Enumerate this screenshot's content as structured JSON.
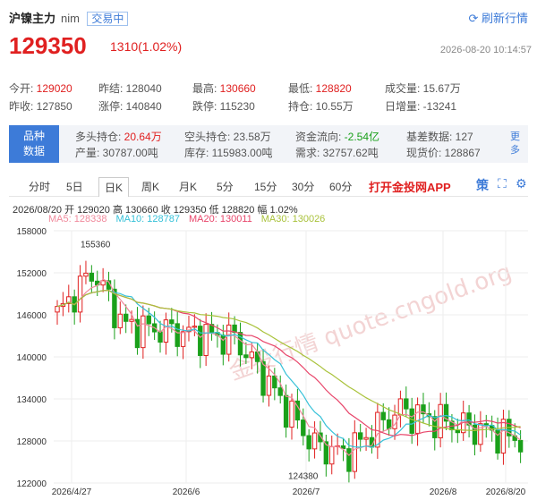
{
  "header": {
    "name": "沪镍主力",
    "code": "nim",
    "status": "交易中",
    "refresh_label": "刷新行情"
  },
  "quote": {
    "price": "129350",
    "change": "1310(1.02%)",
    "timestamp": "2026-08-20 10:14:57"
  },
  "stats": {
    "row1": [
      {
        "label": "今开:",
        "value": "129020",
        "color": "up"
      },
      {
        "label": "昨结:",
        "value": "128040",
        "color": ""
      },
      {
        "label": "最高:",
        "value": "130660",
        "color": "up"
      },
      {
        "label": "最低:",
        "value": "128820",
        "color": "up"
      },
      {
        "label": "成交量:",
        "value": "15.67万",
        "color": ""
      }
    ],
    "row2": [
      {
        "label": "昨收:",
        "value": "127850",
        "color": ""
      },
      {
        "label": "涨停:",
        "value": "140840",
        "color": ""
      },
      {
        "label": "跌停:",
        "value": "115230",
        "color": ""
      },
      {
        "label": "持仓:",
        "value": "10.55万",
        "color": ""
      },
      {
        "label": "日增量:",
        "value": "-13241",
        "color": ""
      }
    ]
  },
  "variety": {
    "badge_line1": "品种",
    "badge_line2": "数据",
    "row1": [
      {
        "label": "多头持仓:",
        "value": "20.64万",
        "color": "up"
      },
      {
        "label": "空头持仓:",
        "value": "23.58万",
        "color": ""
      },
      {
        "label": "资金流向:",
        "value": "-2.54亿",
        "color": "dn"
      },
      {
        "label": "基差数据:",
        "value": "127",
        "color": ""
      }
    ],
    "row2": [
      {
        "label": "产量:",
        "value": "30787.00吨",
        "color": ""
      },
      {
        "label": "库存:",
        "value": "115983.00吨",
        "color": ""
      },
      {
        "label": "需求:",
        "value": "32757.62吨",
        "color": ""
      },
      {
        "label": "现货价:",
        "value": "128867",
        "color": ""
      }
    ],
    "more_label": "更多"
  },
  "tabs": {
    "items": [
      "分时",
      "5日",
      "日K",
      "周K",
      "月K",
      "5分",
      "15分",
      "30分",
      "60分"
    ],
    "active": "日K",
    "app_label": "打开金投网APP",
    "icons": [
      "strategy-icon",
      "fullscreen-icon",
      "settings-icon"
    ],
    "strategy_glyph": "策"
  },
  "ohlc_line": "2026/08/20  开 129020  高 130660  收 129350  低 128820  幅 1.02%",
  "ma": [
    {
      "label": "MA5: 128338",
      "color": "#f08a9c"
    },
    {
      "label": "MA10: 128787",
      "color": "#36c1d8"
    },
    {
      "label": "MA20: 130011",
      "color": "#e8456a"
    },
    {
      "label": "MA30: 130026",
      "color": "#a9c23a"
    }
  ],
  "chart_data": {
    "type": "candlestick",
    "y_ticks": [
      158000,
      152000,
      146000,
      140000,
      134000,
      128000,
      122000
    ],
    "ylim": [
      122000,
      158000
    ],
    "x_ticks": [
      "2026/4/27",
      "2026/6",
      "2026/7",
      "2026/8",
      "2026/8/20"
    ],
    "annotations": [
      {
        "text": "155360",
        "x": "2026/4/27+",
        "value": 155360
      },
      {
        "text": "124380",
        "x": "2026/7+",
        "value": 124380
      }
    ],
    "watermark": "金投行情 quote.cngold.org",
    "colors": {
      "up": "#e02020",
      "down": "#1aa01a",
      "grid": "#eeeeee"
    },
    "candles": []
  }
}
